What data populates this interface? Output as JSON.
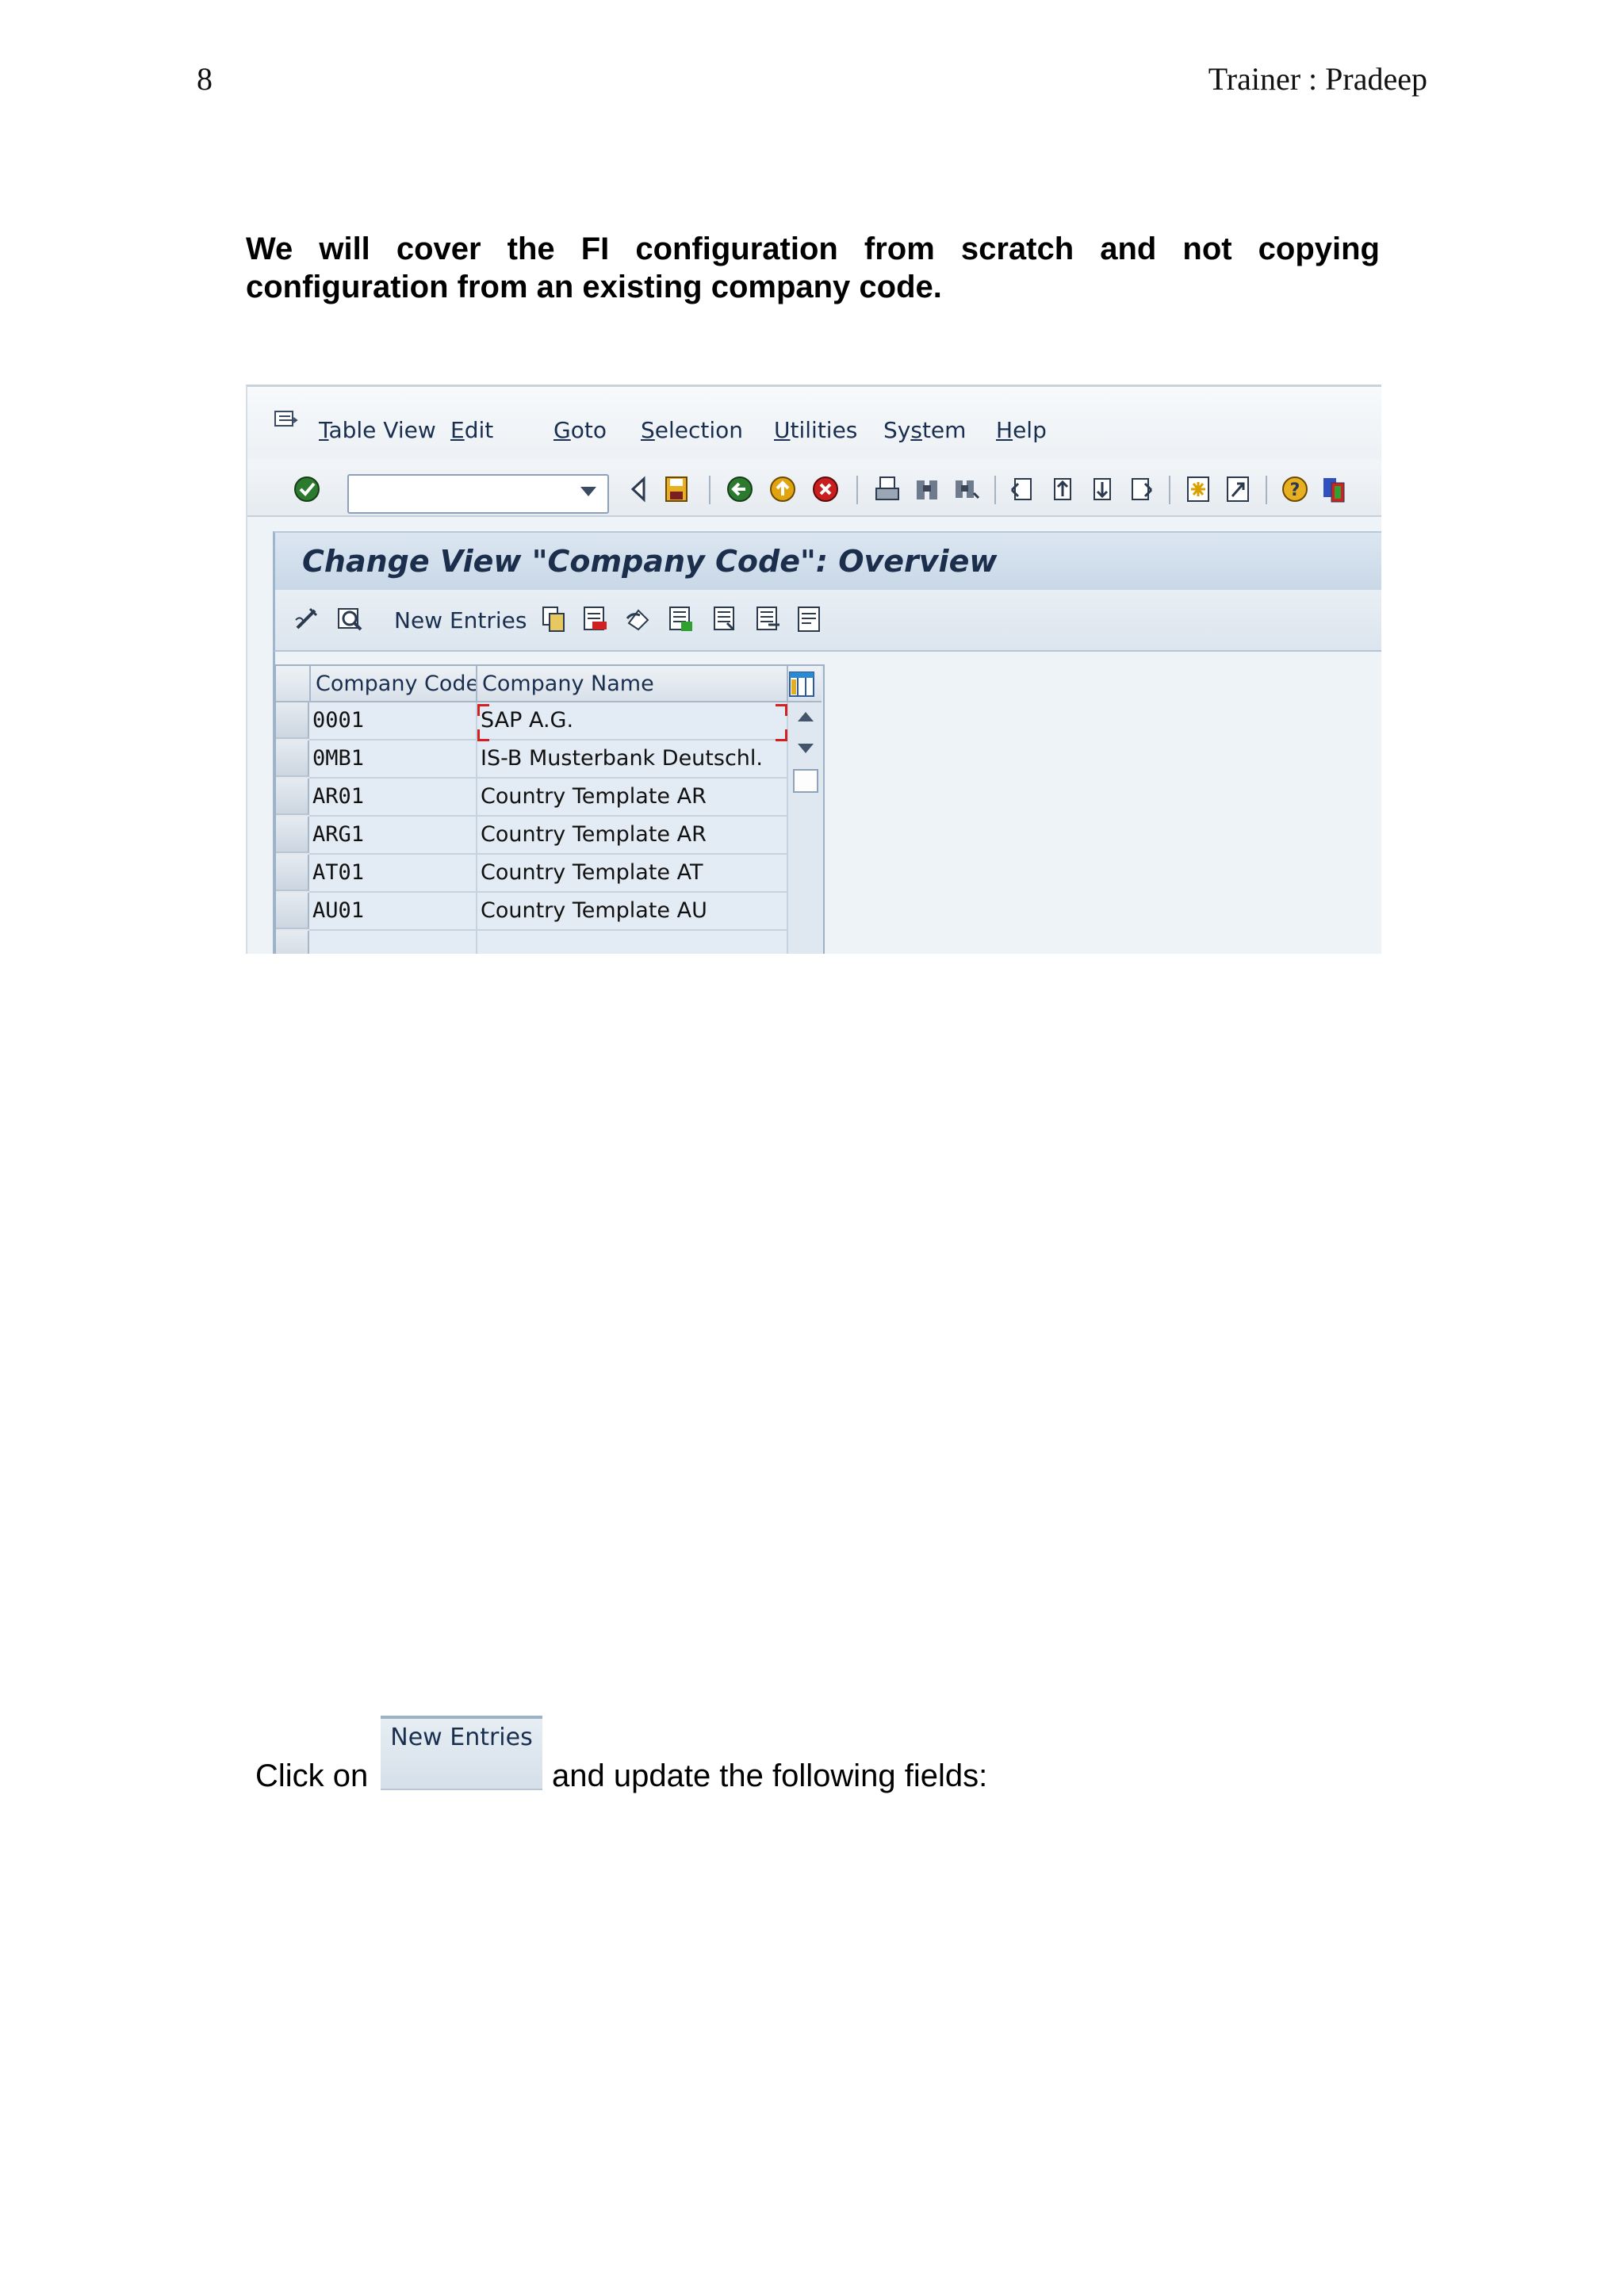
{
  "page": {
    "number": "8",
    "header_right": "Trainer : Pradeep",
    "intro": "We will cover the FI configuration from scratch and not copying configuration from an existing company code."
  },
  "sap": {
    "menu": {
      "items": [
        {
          "underline": "T",
          "rest": "able View"
        },
        {
          "underline": "E",
          "rest": "dit"
        },
        {
          "underline": "G",
          "rest": "oto"
        },
        {
          "underline": "S",
          "rest": "election"
        },
        {
          "underline": "U",
          "rest": "tilities"
        },
        {
          "pre": "Sy",
          "underline": "s",
          "rest": "tem"
        },
        {
          "underline": "H",
          "rest": "elp"
        }
      ]
    },
    "title": "Change View \"Company Code\": Overview",
    "app_toolbar": {
      "new_entries": "New Entries"
    },
    "table": {
      "headers": [
        "Company Code",
        "Company Name"
      ],
      "rows": [
        {
          "code": "0001",
          "name": "SAP A.G."
        },
        {
          "code": "0MB1",
          "name": "IS-B Musterbank Deutschl."
        },
        {
          "code": "AR01",
          "name": "Country Template AR"
        },
        {
          "code": "ARG1",
          "name": "Country Template AR"
        },
        {
          "code": "AT01",
          "name": "Country Template AT"
        },
        {
          "code": "AU01",
          "name": "Country Template AU"
        }
      ]
    },
    "colors": {
      "title_bg": "#c9d8e7",
      "header_text": "#1b2e4c",
      "cell_bg": "#e3ebf4",
      "focus": "#d42020"
    }
  },
  "instruction": {
    "prefix": "Click on",
    "button": "New Entries",
    "suffix": "and update the following fields:"
  }
}
